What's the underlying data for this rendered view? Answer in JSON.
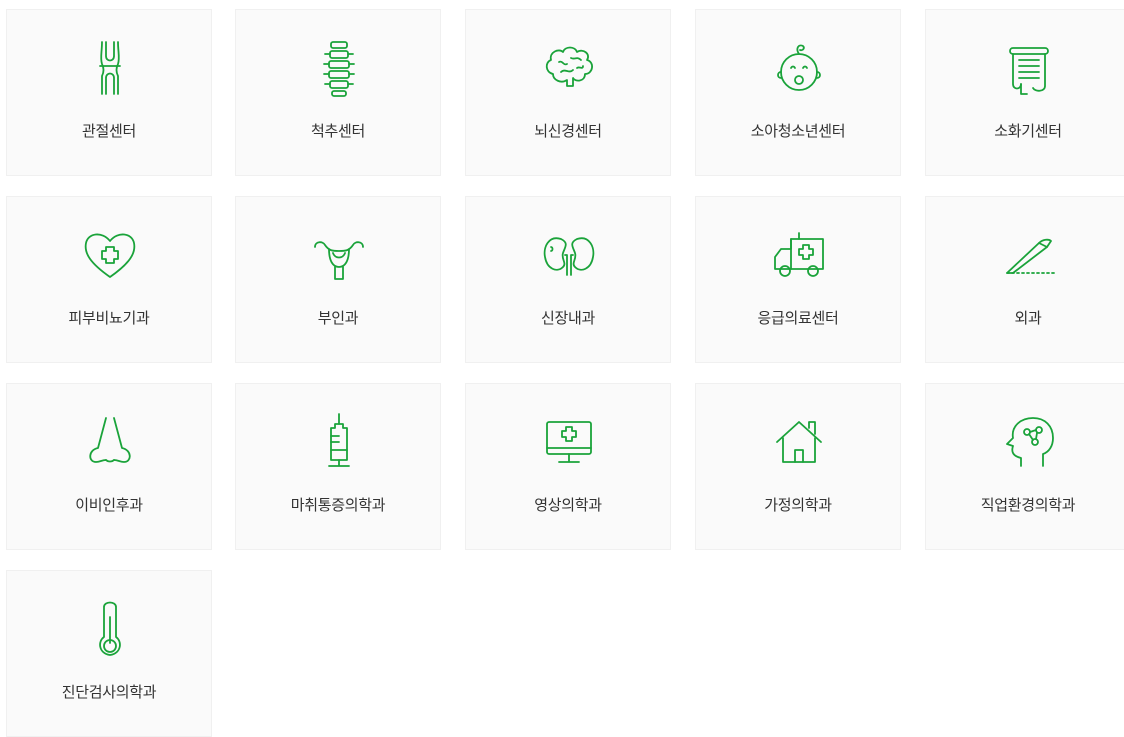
{
  "departments": [
    {
      "label": "관절센터",
      "icon": "knee-joint-icon"
    },
    {
      "label": "척추센터",
      "icon": "spine-icon"
    },
    {
      "label": "뇌신경센터",
      "icon": "brain-icon"
    },
    {
      "label": "소아청소년센터",
      "icon": "baby-icon"
    },
    {
      "label": "소화기센터",
      "icon": "intestine-icon"
    },
    {
      "label": "피부비뇨기과",
      "icon": "heart-cross-icon"
    },
    {
      "label": "부인과",
      "icon": "uterus-icon"
    },
    {
      "label": "신장내과",
      "icon": "kidney-icon"
    },
    {
      "label": "응급의료센터",
      "icon": "ambulance-icon"
    },
    {
      "label": "외과",
      "icon": "scalpel-icon"
    },
    {
      "label": "이비인후과",
      "icon": "nose-icon"
    },
    {
      "label": "마취통증의학과",
      "icon": "syringe-icon"
    },
    {
      "label": "영상의학과",
      "icon": "monitor-cross-icon"
    },
    {
      "label": "가정의학과",
      "icon": "house-icon"
    },
    {
      "label": "직업환경의학과",
      "icon": "head-network-icon"
    },
    {
      "label": "진단검사의학과",
      "icon": "thermometer-icon"
    }
  ],
  "colors": {
    "icon": "#1aa33a",
    "card_bg": "#fafafa",
    "text": "#333333"
  }
}
